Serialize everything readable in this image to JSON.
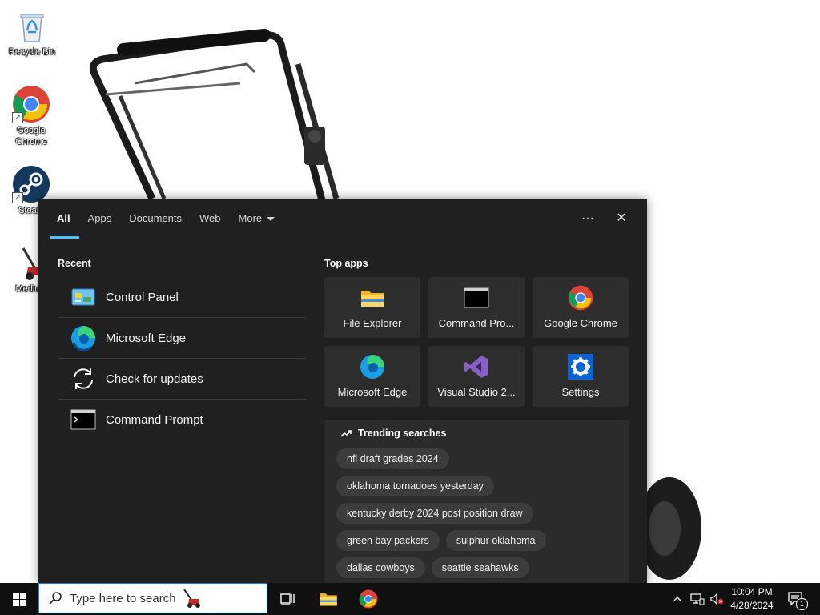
{
  "desktop": {
    "icons": [
      {
        "label": "Recycle Bin"
      },
      {
        "label": "Google Chrome"
      },
      {
        "label": "Steam"
      },
      {
        "label": "Medium"
      }
    ]
  },
  "search_panel": {
    "tabs": [
      {
        "label": "All",
        "active": true
      },
      {
        "label": "Apps"
      },
      {
        "label": "Documents"
      },
      {
        "label": "Web"
      },
      {
        "label": "More"
      }
    ],
    "more_options_label": "···",
    "close_label": "✕",
    "recent": {
      "title": "Recent",
      "items": [
        {
          "label": "Control Panel",
          "icon": "control-panel-icon"
        },
        {
          "label": "Microsoft Edge",
          "icon": "edge-icon"
        },
        {
          "label": "Check for updates",
          "icon": "sync-icon"
        },
        {
          "label": "Command Prompt",
          "icon": "command-prompt-icon"
        }
      ]
    },
    "top_apps": {
      "title": "Top apps",
      "items": [
        {
          "label": "File Explorer",
          "icon": "folder-icon"
        },
        {
          "label": "Command Pro...",
          "icon": "command-prompt-icon"
        },
        {
          "label": "Google Chrome",
          "icon": "chrome-icon"
        },
        {
          "label": "Microsoft Edge",
          "icon": "edge-icon"
        },
        {
          "label": "Visual Studio 2...",
          "icon": "visual-studio-icon"
        },
        {
          "label": "Settings",
          "icon": "gear-icon"
        }
      ]
    },
    "trending": {
      "title": "Trending searches",
      "items": [
        "nfl draft grades 2024",
        "oklahoma tornadoes yesterday",
        "kentucky derby 2024 post position draw",
        "green bay packers",
        "sulphur oklahoma",
        "dallas cowboys",
        "seattle seahawks"
      ]
    }
  },
  "taskbar": {
    "search_placeholder": "Type here to search",
    "clock_time": "10:04 PM",
    "clock_date": "4/28/2024",
    "notification_count": "1"
  },
  "colors": {
    "panel_bg": "#202020",
    "tile_bg": "#2d2d2d",
    "accent": "#4cc2ff",
    "taskbar_bg": "#101010"
  }
}
